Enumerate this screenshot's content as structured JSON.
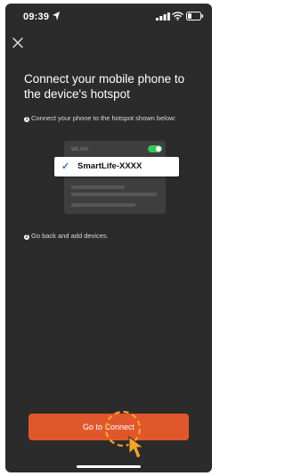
{
  "status_bar": {
    "time": "09:39",
    "location_icon": "location-arrow-icon",
    "signal_icon": "cellular-signal-icon",
    "wifi_icon": "wifi-icon",
    "battery_icon": "battery-icon"
  },
  "header": {
    "close_icon": "close-icon"
  },
  "main": {
    "title": "Connect your mobile phone to the device's hotspot",
    "step1": "Connect your phone to the hotspot shown below:",
    "step2": "Go back and add devices."
  },
  "wlan_illustration": {
    "label": "WLAN",
    "toggle_on": true,
    "selected_network": "SmartLife-XXXX",
    "check_icon": "checkmark-icon"
  },
  "footer": {
    "connect_label": "Go to Connect",
    "hint_icon": "tap-pointer-icon"
  },
  "colors": {
    "background": "#2b2b2b",
    "accent": "#e1572c",
    "toggle": "#34c759",
    "hint": "#f5a623",
    "check": "#2f6fd6"
  }
}
